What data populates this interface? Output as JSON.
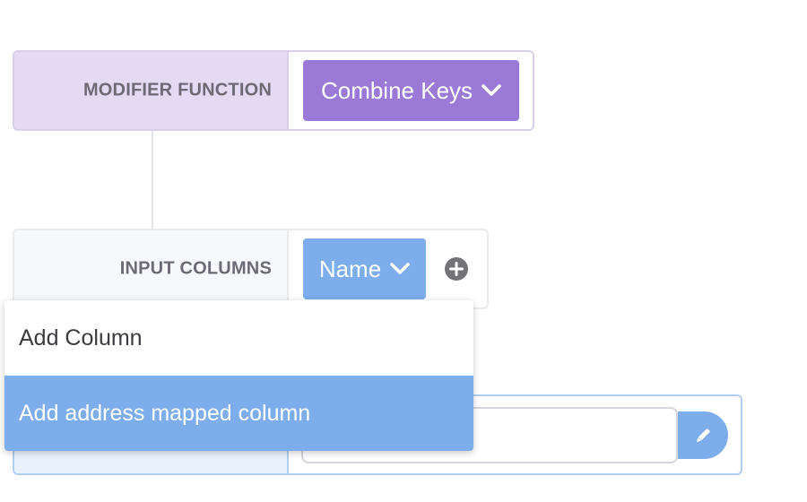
{
  "modifier": {
    "label": "MODIFIER FUNCTION",
    "selected": "Combine Keys"
  },
  "input_columns": {
    "label": "INPUT COLUMNS",
    "selected_column": "Name"
  },
  "third_row": {
    "input_value": ""
  },
  "dropdown": {
    "items": [
      {
        "label": "Add Column",
        "highlighted": false
      },
      {
        "label": "Add address mapped column",
        "highlighted": true
      }
    ]
  },
  "colors": {
    "modifier_accent": "#9a7ad6",
    "modifier_label_bg": "#e4dbf2",
    "input_accent": "#7dadeb",
    "highlight": "#7dadeb"
  },
  "icons": {
    "dropdown": "chevron-down-icon",
    "add": "plus-circle-icon",
    "edit": "pencil-icon"
  }
}
